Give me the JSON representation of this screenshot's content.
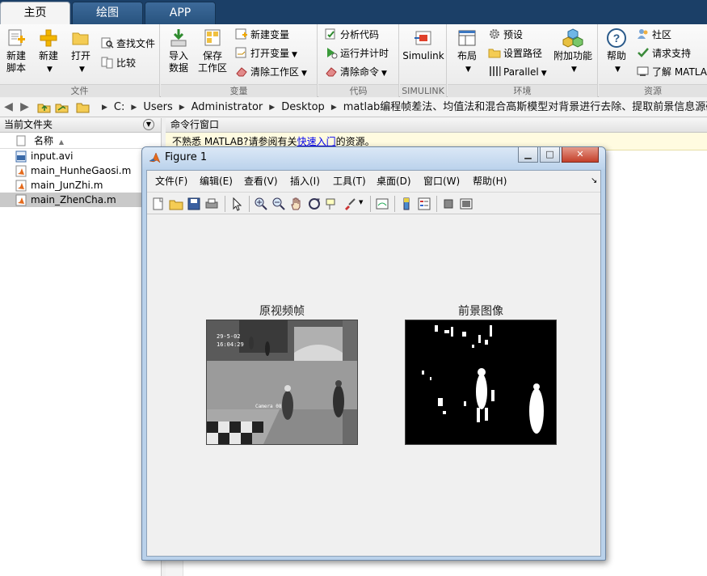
{
  "tabs": [
    {
      "label": "主页",
      "active": true
    },
    {
      "label": "绘图",
      "active": false
    },
    {
      "label": "APP",
      "active": false
    }
  ],
  "ribbon": {
    "file": {
      "group_label": "文件",
      "new_script": "新建\n脚本",
      "new_script_l1": "新建",
      "new_script_l2": "脚本",
      "new": "新建",
      "open": "打开",
      "find_files": "查找文件",
      "compare": "比较"
    },
    "variable": {
      "group_label": "变量",
      "import_l1": "导入",
      "import_l2": "数据",
      "save_l1": "保存",
      "save_l2": "工作区",
      "new_variable": "新建变量",
      "open_variable": "打开变量",
      "clear_workspace": "清除工作区"
    },
    "code": {
      "group_label": "代码",
      "analyze": "分析代码",
      "run_time": "运行并计时",
      "clear_commands": "清除命令"
    },
    "simulink": {
      "group_label": "SIMULINK",
      "simulink": "Simulink"
    },
    "environment": {
      "group_label": "环境",
      "layout": "布局",
      "preferences": "预设",
      "set_path": "设置路径",
      "parallel": "Parallel",
      "addons": "附加功能"
    },
    "resources": {
      "group_label": "资源",
      "help": "帮助",
      "community": "社区",
      "request_support": "请求支持",
      "learn_matlab": "了解 MATLAB"
    }
  },
  "address": {
    "crumbs": [
      "C:",
      "Users",
      "Administrator",
      "Desktop",
      "matlab编程帧差法、均值法和混合高斯模型对背景进行去除、提取前景信息源码程序"
    ]
  },
  "current_folder": {
    "title": "当前文件夹",
    "column_name": "名称",
    "files": [
      {
        "name": "input.avi",
        "type": "avi",
        "selected": false
      },
      {
        "name": "main_HunheGaosi.m",
        "type": "m",
        "selected": false
      },
      {
        "name": "main_JunZhi.m",
        "type": "m",
        "selected": false
      },
      {
        "name": "main_ZhenCha.m",
        "type": "m",
        "selected": true
      }
    ]
  },
  "command_window": {
    "title": "命令行窗口",
    "notice_prefix": "不熟悉 MATLAB?请参阅有关",
    "notice_link": "快速入门",
    "notice_suffix": "的资源。"
  },
  "figure": {
    "title": "Figure 1",
    "menu": [
      "文件(F)",
      "编辑(E)",
      "查看(V)",
      "插入(I)",
      "工具(T)",
      "桌面(D)",
      "窗口(W)",
      "帮助(H)"
    ],
    "axes": [
      {
        "title": "原视频帧",
        "image": "grayscale-surveillance-frame"
      },
      {
        "title": "前景图像",
        "image": "binary-foreground-mask"
      }
    ],
    "frame_overlay_text": [
      "29-5-02",
      "16:04:29",
      "Camera 08"
    ]
  },
  "colors": {
    "tabstrip": "#1b3f67",
    "selected_row": "#c9c9c9",
    "notice_bg": "#fffbe0",
    "link": "#0000ee"
  }
}
